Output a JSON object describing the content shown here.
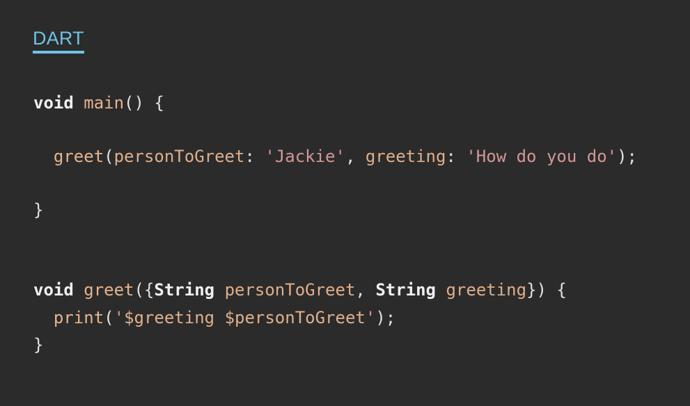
{
  "language_tab": "DART",
  "code": {
    "line1": {
      "kw": "void",
      "sp": " ",
      "fn": "main",
      "rest": "() {"
    },
    "line2": {
      "indent": "  ",
      "fn": "greet",
      "p1": "(",
      "name1": "personToGreet",
      "c1": ": ",
      "s1": "'Jackie'",
      "c2": ", ",
      "name2": "greeting",
      "c3": ": ",
      "s2": "'How do you do'",
      "end": ");"
    },
    "line3": {
      "brace": "}"
    },
    "line4": {
      "kw": "void",
      "sp": " ",
      "fn": "greet",
      "p1": "({",
      "t1": "String",
      "sp2": " ",
      "name1": "personToGreet",
      "c1": ", ",
      "t2": "String",
      "sp3": " ",
      "name2": "greeting",
      "end": "}) {"
    },
    "line5": {
      "indent": "  ",
      "fn": "print",
      "p1": "(",
      "q1": "'",
      "interp1": "$greeting",
      "sp": " ",
      "interp2": "$personToGreet",
      "q2": "'",
      "end": ");"
    },
    "line6": {
      "brace": "}"
    }
  }
}
